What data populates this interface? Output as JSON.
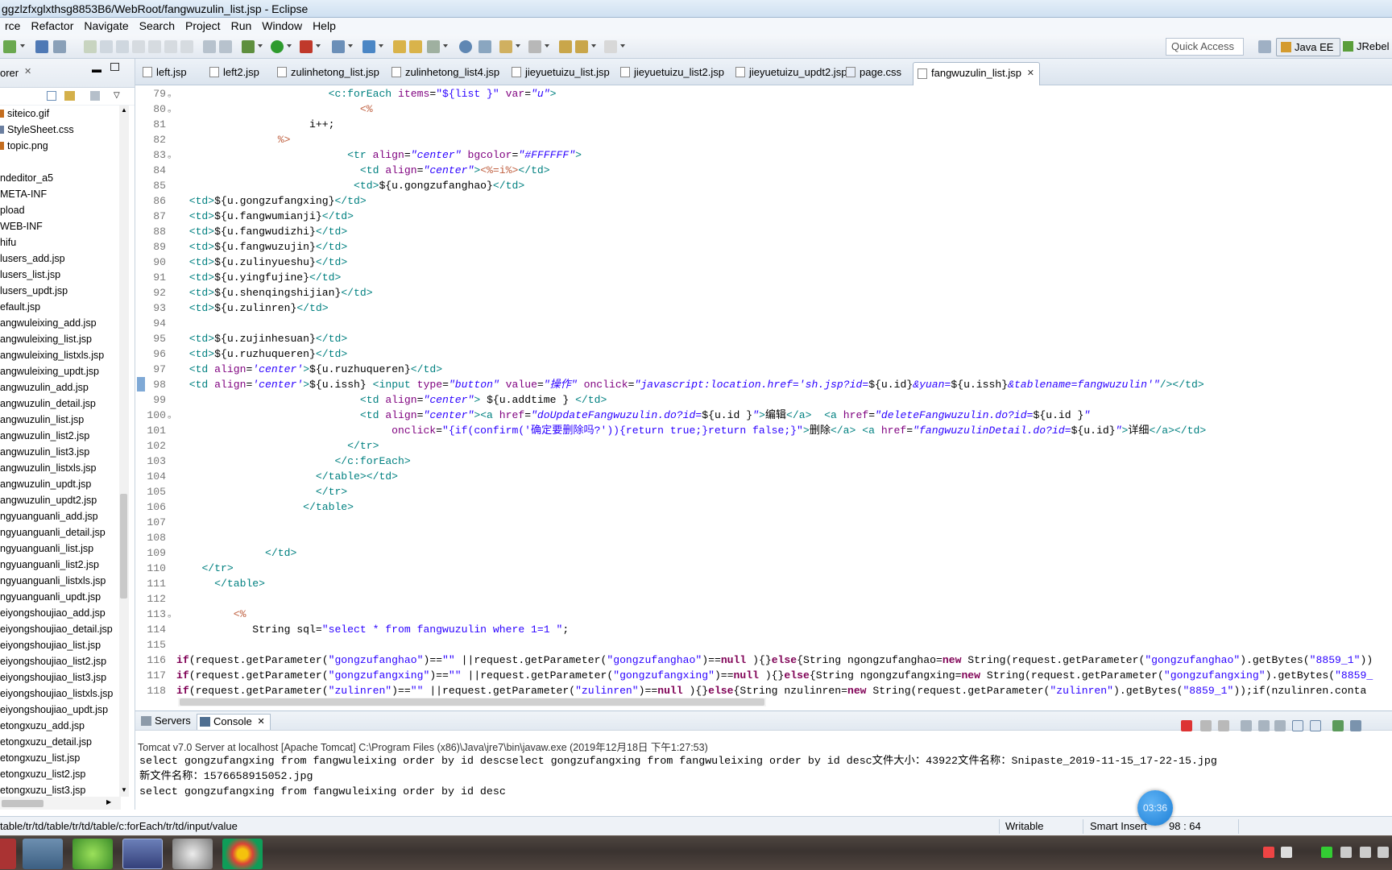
{
  "window": {
    "title": "ggzlzfxglxthsg8853B6/WebRoot/fangwuzulin_list.jsp - Eclipse"
  },
  "menu": [
    "rce",
    "Refactor",
    "Navigate",
    "Search",
    "Project",
    "Run",
    "Window",
    "Help"
  ],
  "quick_access": {
    "label": "Quick Access"
  },
  "perspectives": {
    "java_ee": "Java EE",
    "jrebel": "JRebel"
  },
  "explorer": {
    "title": "orer",
    "files": [
      "siteico.gif",
      "StyleSheet.css",
      "topic.png",
      "",
      "ndeditor_a5",
      "META-INF",
      "pload",
      "WEB-INF",
      "hifu",
      "lusers_add.jsp",
      "lusers_list.jsp",
      "lusers_updt.jsp",
      "efault.jsp",
      "angwuleixing_add.jsp",
      "angwuleixing_list.jsp",
      "angwuleixing_listxls.jsp",
      "angwuleixing_updt.jsp",
      "angwuzulin_add.jsp",
      "angwuzulin_detail.jsp",
      "angwuzulin_list.jsp",
      "angwuzulin_list2.jsp",
      "angwuzulin_list3.jsp",
      "angwuzulin_listxls.jsp",
      "angwuzulin_updt.jsp",
      "angwuzulin_updt2.jsp",
      "ngyuanguanli_add.jsp",
      "ngyuanguanli_detail.jsp",
      "ngyuanguanli_list.jsp",
      "ngyuanguanli_list2.jsp",
      "ngyuanguanli_listxls.jsp",
      "ngyuanguanli_updt.jsp",
      "eiyongshoujiao_add.jsp",
      "eiyongshoujiao_detail.jsp",
      "eiyongshoujiao_list.jsp",
      "eiyongshoujiao_list2.jsp",
      "eiyongshoujiao_list3.jsp",
      "eiyongshoujiao_listxls.jsp",
      "eiyongshoujiao_updt.jsp",
      "etongxuzu_add.jsp",
      "etongxuzu_detail.jsp",
      "etongxuzu_list.jsp",
      "etongxuzu_list2.jsp",
      "etongxuzu_list3.jsp"
    ]
  },
  "tabs": [
    "left.jsp",
    "left2.jsp",
    "zulinhetong_list.jsp",
    "zulinhetong_list4.jsp",
    "jieyuetuizu_list.jsp",
    "jieyuetuizu_list2.jsp",
    "jieyuetuizu_updt2.jsp",
    "page.css",
    "fangwuzulin_list.jsp"
  ],
  "active_tab": "fangwuzulin_list.jsp",
  "code": [
    {
      "n": "79",
      "fold": true,
      "s": [
        [
          "p",
          "                        "
        ],
        [
          "tag",
          "<c:forEach "
        ],
        [
          "att",
          "items"
        ],
        [
          "p",
          "="
        ],
        [
          "dq",
          "\"${list }\""
        ],
        [
          "p",
          " "
        ],
        [
          "att",
          "var"
        ],
        [
          "p",
          "="
        ],
        [
          "str",
          "\"u\""
        ],
        [
          "tag",
          ">"
        ]
      ]
    },
    {
      "n": "80",
      "fold": true,
      "s": [
        [
          "p",
          "                             "
        ],
        [
          "jsp",
          "<%"
        ]
      ]
    },
    {
      "n": "81",
      "s": [
        [
          "p",
          "                     i++;"
        ]
      ]
    },
    {
      "n": "82",
      "s": [
        [
          "p",
          "                "
        ],
        [
          "jsp",
          "%>"
        ]
      ]
    },
    {
      "n": "83",
      "fold": true,
      "s": [
        [
          "p",
          "                           "
        ],
        [
          "tag",
          "<tr "
        ],
        [
          "att",
          "align"
        ],
        [
          "p",
          "="
        ],
        [
          "str",
          "\"center\""
        ],
        [
          "p",
          " "
        ],
        [
          "att",
          "bgcolor"
        ],
        [
          "p",
          "="
        ],
        [
          "str",
          "\"#FFFFFF\""
        ],
        [
          "tag",
          ">"
        ]
      ]
    },
    {
      "n": "84",
      "s": [
        [
          "p",
          "                             "
        ],
        [
          "tag",
          "<td "
        ],
        [
          "att",
          "align"
        ],
        [
          "p",
          "="
        ],
        [
          "str",
          "\"center\""
        ],
        [
          "tag",
          ">"
        ],
        [
          "jsp",
          "<%=i%>"
        ],
        [
          "tag",
          "</td>"
        ]
      ]
    },
    {
      "n": "85",
      "s": [
        [
          "p",
          "                            "
        ],
        [
          "tag",
          "<td>"
        ],
        [
          "p",
          "${u.gongzufanghao}"
        ],
        [
          "tag",
          "</td>"
        ]
      ]
    },
    {
      "n": "86",
      "s": [
        [
          "p",
          "  "
        ],
        [
          "tag",
          "<td>"
        ],
        [
          "p",
          "${u.gongzufangxing}"
        ],
        [
          "tag",
          "</td>"
        ]
      ]
    },
    {
      "n": "87",
      "s": [
        [
          "p",
          "  "
        ],
        [
          "tag",
          "<td>"
        ],
        [
          "p",
          "${u.fangwumianji}"
        ],
        [
          "tag",
          "</td>"
        ]
      ]
    },
    {
      "n": "88",
      "s": [
        [
          "p",
          "  "
        ],
        [
          "tag",
          "<td>"
        ],
        [
          "p",
          "${u.fangwudizhi}"
        ],
        [
          "tag",
          "</td>"
        ]
      ]
    },
    {
      "n": "89",
      "s": [
        [
          "p",
          "  "
        ],
        [
          "tag",
          "<td>"
        ],
        [
          "p",
          "${u.fangwuzujin}"
        ],
        [
          "tag",
          "</td>"
        ]
      ]
    },
    {
      "n": "90",
      "s": [
        [
          "p",
          "  "
        ],
        [
          "tag",
          "<td>"
        ],
        [
          "p",
          "${u.zulinyueshu}"
        ],
        [
          "tag",
          "</td>"
        ]
      ]
    },
    {
      "n": "91",
      "s": [
        [
          "p",
          "  "
        ],
        [
          "tag",
          "<td>"
        ],
        [
          "p",
          "${u.yingfujine}"
        ],
        [
          "tag",
          "</td>"
        ]
      ]
    },
    {
      "n": "92",
      "s": [
        [
          "p",
          "  "
        ],
        [
          "tag",
          "<td>"
        ],
        [
          "p",
          "${u.shenqingshijian}"
        ],
        [
          "tag",
          "</td>"
        ]
      ]
    },
    {
      "n": "93",
      "s": [
        [
          "p",
          "  "
        ],
        [
          "tag",
          "<td>"
        ],
        [
          "p",
          "${u.zulinren}"
        ],
        [
          "tag",
          "</td>"
        ]
      ]
    },
    {
      "n": "94",
      "s": []
    },
    {
      "n": "95",
      "s": [
        [
          "p",
          "  "
        ],
        [
          "tag",
          "<td>"
        ],
        [
          "p",
          "${u.zujinhesuan}"
        ],
        [
          "tag",
          "</td>"
        ]
      ]
    },
    {
      "n": "96",
      "s": [
        [
          "p",
          "  "
        ],
        [
          "tag",
          "<td>"
        ],
        [
          "p",
          "${u.ruzhuqueren}"
        ],
        [
          "tag",
          "</td>"
        ]
      ]
    },
    {
      "n": "97",
      "s": [
        [
          "p",
          "  "
        ],
        [
          "tag",
          "<td "
        ],
        [
          "att",
          "align"
        ],
        [
          "p",
          "="
        ],
        [
          "str",
          "'center'"
        ],
        [
          "tag",
          ">"
        ],
        [
          "p",
          "${u.ruzhuqueren}"
        ],
        [
          "tag",
          "</td>"
        ]
      ]
    },
    {
      "n": "98",
      "mark": true,
      "s": [
        [
          "p",
          "  "
        ],
        [
          "tag",
          "<td "
        ],
        [
          "att",
          "align"
        ],
        [
          "p",
          "="
        ],
        [
          "str",
          "'center'"
        ],
        [
          "tag",
          ">"
        ],
        [
          "p",
          "${u.issh} "
        ],
        [
          "tag",
          "<input "
        ],
        [
          "att",
          "type"
        ],
        [
          "p",
          "="
        ],
        [
          "str",
          "\"button\""
        ],
        [
          "p",
          " "
        ],
        [
          "att",
          "value"
        ],
        [
          "p",
          "="
        ],
        [
          "str",
          "\"操作\""
        ],
        [
          "p",
          " "
        ],
        [
          "att",
          "onclick"
        ],
        [
          "p",
          "="
        ],
        [
          "str",
          "\"javascript:location.href='sh.jsp?id="
        ],
        [
          "p",
          "${u.id}"
        ],
        [
          "str",
          "&yuan="
        ],
        [
          "p",
          "${u.issh}"
        ],
        [
          "str",
          "&tablename=fangwuzulin'\""
        ],
        [
          "tag",
          "/></td>"
        ]
      ]
    },
    {
      "n": "99",
      "s": [
        [
          "p",
          "                             "
        ],
        [
          "tag",
          "<td "
        ],
        [
          "att",
          "align"
        ],
        [
          "p",
          "="
        ],
        [
          "str",
          "\"center\""
        ],
        [
          "tag",
          "> "
        ],
        [
          "p",
          "${u.addtime } "
        ],
        [
          "tag",
          "</td>"
        ]
      ]
    },
    {
      "n": "100",
      "fold": true,
      "s": [
        [
          "p",
          "                             "
        ],
        [
          "tag",
          "<td "
        ],
        [
          "att",
          "align"
        ],
        [
          "p",
          "="
        ],
        [
          "str",
          "\"center\""
        ],
        [
          "tag",
          "><a "
        ],
        [
          "att",
          "href"
        ],
        [
          "p",
          "="
        ],
        [
          "str",
          "\"doUpdateFangwuzulin.do?id="
        ],
        [
          "p",
          "${u.id }"
        ],
        [
          "str",
          "\""
        ],
        [
          "tag",
          ">"
        ],
        [
          "p",
          "编辑"
        ],
        [
          "tag",
          "</a>"
        ],
        [
          "p",
          "  "
        ],
        [
          "tag",
          "<a "
        ],
        [
          "att",
          "href"
        ],
        [
          "p",
          "="
        ],
        [
          "str",
          "\"deleteFangwuzulin.do?id="
        ],
        [
          "p",
          "${u.id }"
        ],
        [
          "str",
          "\""
        ]
      ]
    },
    {
      "n": "101",
      "s": [
        [
          "p",
          "                                  "
        ],
        [
          "att",
          "onclick"
        ],
        [
          "p",
          "="
        ],
        [
          "dq",
          "\"{if(confirm('确定要删除吗?')){return true;}return false;}\""
        ],
        [
          "tag",
          ">"
        ],
        [
          "p",
          "删除"
        ],
        [
          "tag",
          "</a> <a "
        ],
        [
          "att",
          "href"
        ],
        [
          "p",
          "="
        ],
        [
          "str",
          "\"fangwuzulinDetail.do?id="
        ],
        [
          "p",
          "${u.id}"
        ],
        [
          "str",
          "\""
        ],
        [
          "tag",
          ">"
        ],
        [
          "p",
          "详细"
        ],
        [
          "tag",
          "</a></td>"
        ]
      ]
    },
    {
      "n": "102",
      "s": [
        [
          "p",
          "                           "
        ],
        [
          "tag",
          "</tr>"
        ]
      ]
    },
    {
      "n": "103",
      "s": [
        [
          "p",
          "                         "
        ],
        [
          "tag",
          "</c:forEach>"
        ]
      ]
    },
    {
      "n": "104",
      "s": [
        [
          "p",
          "                      "
        ],
        [
          "tag",
          "</table></td>"
        ]
      ]
    },
    {
      "n": "105",
      "s": [
        [
          "p",
          "                      "
        ],
        [
          "tag",
          "</tr>"
        ]
      ]
    },
    {
      "n": "106",
      "s": [
        [
          "p",
          "                    "
        ],
        [
          "tag",
          "</table>"
        ]
      ]
    },
    {
      "n": "107",
      "s": []
    },
    {
      "n": "108",
      "s": []
    },
    {
      "n": "109",
      "s": [
        [
          "p",
          "              "
        ],
        [
          "tag",
          "</td>"
        ]
      ]
    },
    {
      "n": "110",
      "s": [
        [
          "p",
          "    "
        ],
        [
          "tag",
          "</tr>"
        ]
      ]
    },
    {
      "n": "111",
      "s": [
        [
          "p",
          "      "
        ],
        [
          "tag",
          "</table>"
        ]
      ]
    },
    {
      "n": "112",
      "s": []
    },
    {
      "n": "113",
      "fold": true,
      "s": [
        [
          "p",
          "         "
        ],
        [
          "jsp",
          "<%"
        ]
      ]
    },
    {
      "n": "114",
      "s": [
        [
          "p",
          "            String sql="
        ],
        [
          "dq",
          "\"select * from fangwuzulin where 1=1 \""
        ],
        [
          "p",
          ";"
        ]
      ]
    },
    {
      "n": "115",
      "s": []
    },
    {
      "n": "116",
      "s": [
        [
          "kw",
          "if"
        ],
        [
          "p",
          "(request.getParameter("
        ],
        [
          "dq",
          "\"gongzufanghao\""
        ],
        [
          "p",
          ")=="
        ],
        [
          "dq",
          "\"\""
        ],
        [
          "p",
          " ||request.getParameter("
        ],
        [
          "dq",
          "\"gongzufanghao\""
        ],
        [
          "p",
          ")=="
        ],
        [
          "kw",
          "null"
        ],
        [
          "p",
          " ){}"
        ],
        [
          "kw",
          "else"
        ],
        [
          "p",
          "{String ngongzufanghao="
        ],
        [
          "kw",
          "new"
        ],
        [
          "p",
          " String(request.getParameter("
        ],
        [
          "dq",
          "\"gongzufanghao\""
        ],
        [
          "p",
          ").getBytes("
        ],
        [
          "dq",
          "\"8859_1\""
        ],
        [
          "p",
          "))"
        ]
      ]
    },
    {
      "n": "117",
      "s": [
        [
          "kw",
          "if"
        ],
        [
          "p",
          "(request.getParameter("
        ],
        [
          "dq",
          "\"gongzufangxing\""
        ],
        [
          "p",
          ")=="
        ],
        [
          "dq",
          "\"\""
        ],
        [
          "p",
          " ||request.getParameter("
        ],
        [
          "dq",
          "\"gongzufangxing\""
        ],
        [
          "p",
          ")=="
        ],
        [
          "kw",
          "null"
        ],
        [
          "p",
          " ){}"
        ],
        [
          "kw",
          "else"
        ],
        [
          "p",
          "{String ngongzufangxing="
        ],
        [
          "kw",
          "new"
        ],
        [
          "p",
          " String(request.getParameter("
        ],
        [
          "dq",
          "\"gongzufangxing\""
        ],
        [
          "p",
          ").getBytes("
        ],
        [
          "dq",
          "\"8859_"
        ]
      ]
    },
    {
      "n": "118",
      "s": [
        [
          "kw",
          "if"
        ],
        [
          "p",
          "(request.getParameter("
        ],
        [
          "dq",
          "\"zulinren\""
        ],
        [
          "p",
          ")=="
        ],
        [
          "dq",
          "\"\""
        ],
        [
          "p",
          " ||request.getParameter("
        ],
        [
          "dq",
          "\"zulinren\""
        ],
        [
          "p",
          ")=="
        ],
        [
          "kw",
          "null"
        ],
        [
          "p",
          " ){}"
        ],
        [
          "kw",
          "else"
        ],
        [
          "p",
          "{String nzulinren="
        ],
        [
          "kw",
          "new"
        ],
        [
          "p",
          " String(request.getParameter("
        ],
        [
          "dq",
          "\"zulinren\""
        ],
        [
          "p",
          ").getBytes("
        ],
        [
          "dq",
          "\"8859_1\""
        ],
        [
          "p",
          "));if(nzulinren.conta"
        ]
      ]
    }
  ],
  "console": {
    "tabs": {
      "servers": "Servers",
      "console": "Console"
    },
    "info": "Tomcat v7.0 Server at localhost [Apache Tomcat] C:\\Program Files (x86)\\Java\\jre7\\bin\\javaw.exe (2019年12月18日 下午1:27:53)",
    "lines": [
      "select gongzufangxing from fangwuleixing order by id descselect gongzufangxing from fangwuleixing order by id desc文件大小：43922文件名称：Snipaste_2019-11-15_17-22-15.jpg",
      "新文件名称：1576658915052.jpg",
      "select gongzufangxing from fangwuleixing order by id desc"
    ]
  },
  "status": {
    "path": "table/tr/td/table/tr/td/table/c:forEach/tr/td/input/value",
    "writable": "Writable",
    "insert_mode": "Smart Insert",
    "position": "98 : 64"
  },
  "timer": {
    "label": "03:36"
  },
  "taskbar": {
    "apps": [
      "app-1",
      "file-manager",
      "360-browser",
      "eclipse",
      "media-app",
      "chrome"
    ]
  }
}
